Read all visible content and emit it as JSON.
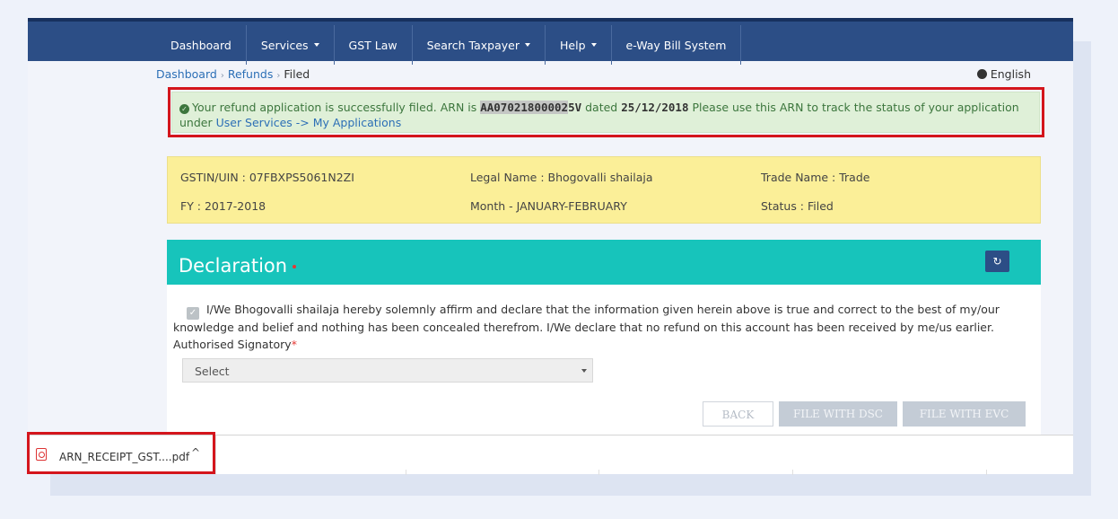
{
  "nav": {
    "items": [
      {
        "label": "Dashboard",
        "dropdown": false
      },
      {
        "label": "Services",
        "dropdown": true
      },
      {
        "label": "GST Law",
        "dropdown": false
      },
      {
        "label": "Search Taxpayer",
        "dropdown": true
      },
      {
        "label": "Help",
        "dropdown": true
      },
      {
        "label": "e-Way Bill System",
        "dropdown": false
      }
    ]
  },
  "breadcrumb": {
    "items": [
      "Dashboard",
      "Refunds",
      "Filed"
    ],
    "separator": "›"
  },
  "language": "English",
  "alert": {
    "prefix": "Your refund application is successfully filed. ARN is ",
    "arn_highlighted": "AA07021800002",
    "arn_rest": "5V",
    "mid": " dated ",
    "date": "25/12/2018",
    "suffix": " Please use this ARN to track the status of your application under ",
    "link": "User Services -> My Applications"
  },
  "info": {
    "gstin": "GSTIN/UIN : 07FBXPS5061N2ZI",
    "legal_name": "Legal Name : Bhogovalli shailaja",
    "trade_name": "Trade Name : Trade",
    "fy": "FY : 2017-2018",
    "month": "Month - JANUARY-FEBRUARY",
    "status": "Status : Filed"
  },
  "declaration": {
    "title": "Declaration",
    "text": "I/We Bhogovalli shailaja hereby solemnly affirm and declare that the information given herein above is true and correct to the best of my/our knowledge and belief and nothing has been concealed therefrom. I/We declare that no refund on this account has been received by me/us earlier.",
    "checked": true,
    "signatory_label": "Authorised Signatory",
    "signatory_value": "Select"
  },
  "buttons": {
    "back": "BACK",
    "file_dsc": "FILE WITH DSC",
    "file_evc": "FILE WITH EVC"
  },
  "download": {
    "filename": "ARN_RECEIPT_GST....pdf",
    "icon": "pdf-icon"
  },
  "colors": {
    "nav_bg": "#2c4e86",
    "header_teal": "#17c4bb",
    "alert_bg": "#dff0d8",
    "info_bg": "#fbef98",
    "highlight_red": "#d4151c"
  }
}
